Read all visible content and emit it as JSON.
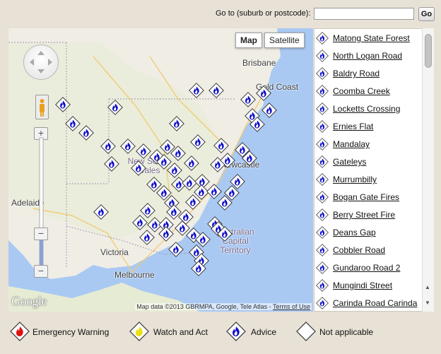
{
  "search": {
    "label": "Go to (suburb or postcode):",
    "value": "",
    "placeholder": "",
    "button": "Go"
  },
  "map": {
    "type_buttons": [
      {
        "label": "Map",
        "selected": true
      },
      {
        "label": "Satellite",
        "selected": false
      }
    ],
    "places": {
      "brisbane": "Brisbane",
      "gold_coast": "Gold Coast",
      "newcastle": "Newcastle",
      "adelaide": "Adelaide",
      "victoria": "Victoria",
      "melbourne": "Melbourne"
    },
    "regions": {
      "nsw": "New South Wales",
      "act": "Australian Capital Territory"
    },
    "logo": "Google",
    "attribution": "Map data ©2013 GBRMPA, Google, Tele Atlas - ",
    "terms_link": "Terms of Use"
  },
  "incidents": [
    "Matong State Forest",
    "North Logan Road",
    "Baldry Road",
    "Coomba Creek",
    "Locketts Crossing",
    "Ernies Flat",
    "Mandalay",
    "Gateleys",
    "Murrumbilly",
    "Bogan Gate Fires",
    "Berry Street Fire",
    "Deans Gap",
    "Cobbler Road",
    "Gundaroo Road 2",
    "Mungindi Street",
    "Carinda Road Carinda"
  ],
  "legend": [
    {
      "label": "Emergency Warning",
      "icon": "red-fire-diamond-icon",
      "color": "#e01010"
    },
    {
      "label": "Watch and Act",
      "icon": "yellow-fire-diamond-icon",
      "color": "#e8e010"
    },
    {
      "label": "Advice",
      "icon": "blue-fire-diamond-icon",
      "color": "#1010c8"
    },
    {
      "label": "Not applicable",
      "icon": "white-diamond-icon",
      "color": "#ffffff"
    }
  ],
  "colors": {
    "advice_blue": "#1010c8",
    "water": "#a9c9f3",
    "land": "#f0ede5",
    "background": "#e8e1d6"
  }
}
